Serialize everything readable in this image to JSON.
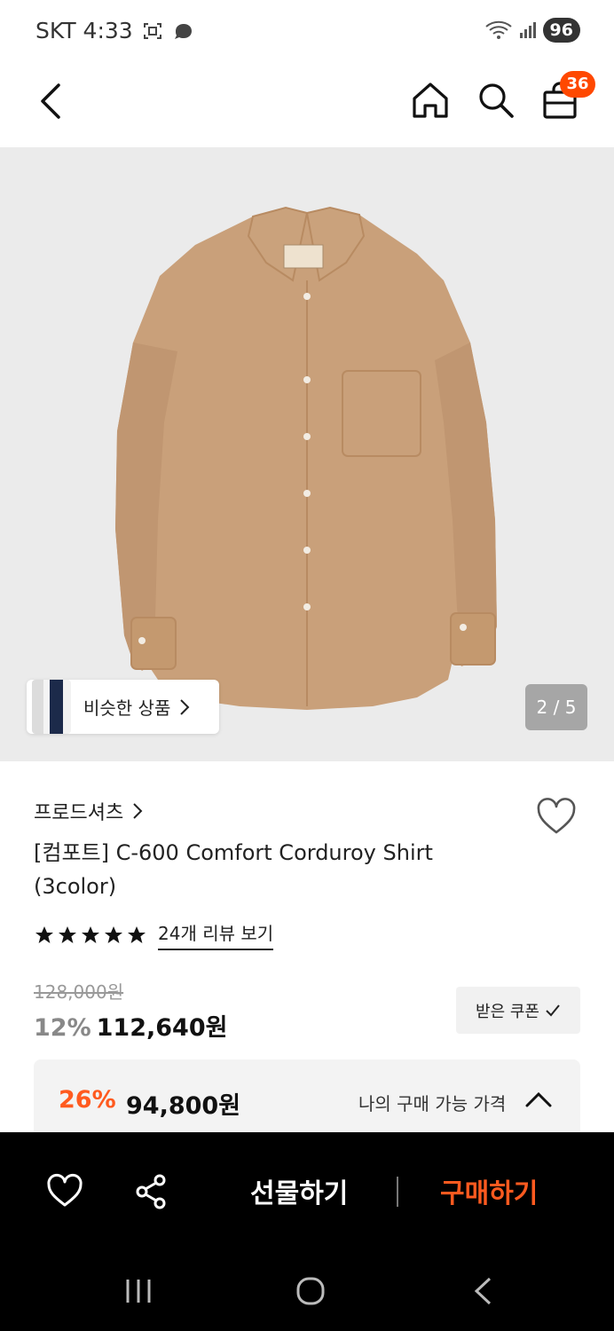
{
  "status_bar": {
    "carrier_time": "SKT 4:33",
    "battery": "96"
  },
  "header": {
    "cart_count": "36"
  },
  "gallery": {
    "similar_label": "비슷한 상품",
    "page_indicator": "2 / 5"
  },
  "product": {
    "brand": "프로드셔츠",
    "title": "[컴포트] C-600 Comfort Corduroy Shirt (3color)",
    "review_link": "24개 리뷰 보기",
    "original_price": "128,000원",
    "discount": "12%",
    "sale_price": "112,640원",
    "coupon_label": "받은 쿠폰",
    "my_discount": "26%",
    "my_price": "94,800원",
    "my_price_label": "나의 구매 가능 가격"
  },
  "action_bar": {
    "gift_label": "선물하기",
    "buy_label": "구매하기"
  },
  "colors": {
    "accent": "#ff5a1f",
    "badge": "#ff4800",
    "shirt": "#c9a07a"
  }
}
